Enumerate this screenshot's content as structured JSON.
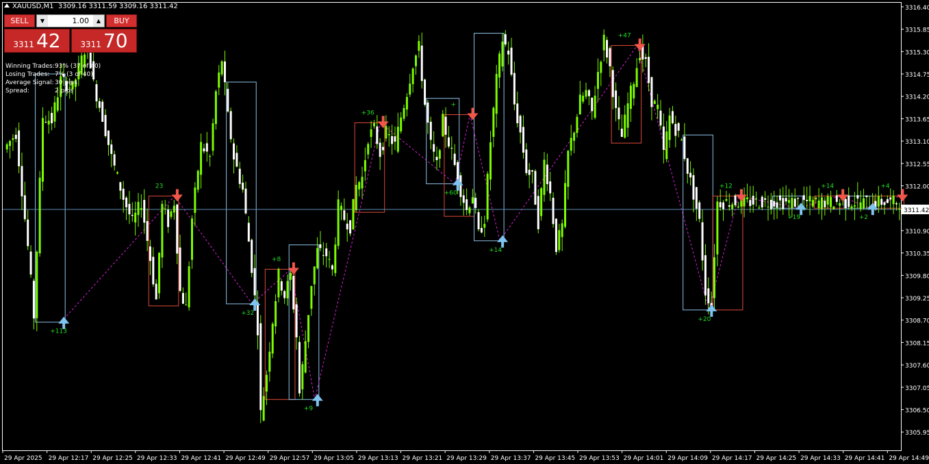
{
  "header": {
    "symbol": "XAUUSD,M1",
    "ohlc": "3309.16 3311.59 3309.16 3311.42"
  },
  "trade_panel": {
    "sell_label": "SELL",
    "buy_label": "BUY",
    "lot": "1.00",
    "sell_small": "3311",
    "sell_big": "42",
    "buy_small": "3311",
    "buy_big": "70",
    "spin_down": "▼",
    "spin_up": "▲"
  },
  "stats": [
    {
      "key": "Winning Trades:",
      "value": "93% (37 of 40)"
    },
    {
      "key": "Losing Trades:",
      "value": "7% (3 of 40)"
    },
    {
      "key": "Average Signal:",
      "value": "30 pips"
    },
    {
      "key": "Spread:",
      "value": "2 pips"
    }
  ],
  "colors": {
    "background": "#000000",
    "bull_candle": "#7CFC00",
    "bear_candle": "#FFFFFF",
    "sell_box": "#E04B3A",
    "buy_box": "#8EC3E8",
    "sell_arrow": "#F0574A",
    "buy_arrow": "#7FC4F0",
    "zigzag": "#E020E0",
    "bid_line": "#5B8DB8",
    "axis": "#FFFFFF",
    "label_green": "#22DD22"
  },
  "chart_data": {
    "type": "candlestick",
    "symbol": "XAUUSD",
    "timeframe": "M1",
    "ylim": [
      3305.5,
      3316.5
    ],
    "y_ticks": [
      "3316.40",
      "3315.85",
      "3315.30",
      "3314.75",
      "3314.20",
      "3313.65",
      "3313.10",
      "3312.55",
      "3312.00",
      "3311.42",
      "3310.90",
      "3310.35",
      "3309.80",
      "3309.25",
      "3308.70",
      "3308.15",
      "3307.60",
      "3307.05",
      "3306.50",
      "3305.95"
    ],
    "x_ticks": [
      "29 Apr 2025",
      "29 Apr 12:17",
      "29 Apr 12:25",
      "29 Apr 12:33",
      "29 Apr 12:41",
      "29 Apr 12:49",
      "29 Apr 12:57",
      "29 Apr 13:05",
      "29 Apr 13:13",
      "29 Apr 13:21",
      "29 Apr 13:29",
      "29 Apr 13:37",
      "29 Apr 13:45",
      "29 Apr 13:53",
      "29 Apr 14:01",
      "29 Apr 14:09",
      "29 Apr 14:17",
      "29 Apr 14:25",
      "29 Apr 14:33",
      "29 Apr 14:41",
      "29 Apr 14:49"
    ],
    "current_price": 3311.42,
    "anchors": [
      [
        0,
        3312.9
      ],
      [
        4,
        3313.3
      ],
      [
        8,
        3310.5
      ],
      [
        10,
        3308.8
      ],
      [
        13,
        3313.7
      ],
      [
        16,
        3313.6
      ],
      [
        19,
        3314.6
      ],
      [
        23,
        3314.4
      ],
      [
        26,
        3315.1
      ],
      [
        28,
        3315.6
      ],
      [
        30,
        3314.5
      ],
      [
        33,
        3313.7
      ],
      [
        36,
        3312.7
      ],
      [
        40,
        3311.7
      ],
      [
        43,
        3311.1
      ],
      [
        46,
        3311.6
      ],
      [
        49,
        3310.2
      ],
      [
        51,
        3309.2
      ],
      [
        53,
        3311.5
      ],
      [
        55,
        3311.1
      ],
      [
        57,
        3311.6
      ],
      [
        59,
        3309.4
      ],
      [
        61,
        3309.0
      ],
      [
        63,
        3311.2
      ],
      [
        66,
        3313.0
      ],
      [
        69,
        3312.7
      ],
      [
        71,
        3314.3
      ],
      [
        73,
        3315.1
      ],
      [
        75,
        3313.7
      ],
      [
        77,
        3312.7
      ],
      [
        80,
        3311.9
      ],
      [
        83,
        3310.0
      ],
      [
        85,
        3308.5
      ],
      [
        86,
        3306.4
      ],
      [
        88,
        3307.4
      ],
      [
        90,
        3308.7
      ],
      [
        92,
        3309.8
      ],
      [
        94,
        3309.3
      ],
      [
        96,
        3309.8
      ],
      [
        98,
        3308.3
      ],
      [
        99,
        3306.9
      ],
      [
        101,
        3308.2
      ],
      [
        103,
        3309.6
      ],
      [
        105,
        3310.4
      ],
      [
        108,
        3310.3
      ],
      [
        110,
        3309.9
      ],
      [
        112,
        3311.5
      ],
      [
        114,
        3311.2
      ],
      [
        116,
        3311.0
      ],
      [
        118,
        3312.0
      ],
      [
        120,
        3312.2
      ],
      [
        122,
        3313.2
      ],
      [
        124,
        3313.4
      ],
      [
        126,
        3312.8
      ],
      [
        128,
        3313.3
      ],
      [
        131,
        3313.0
      ],
      [
        133,
        3313.7
      ],
      [
        135,
        3314.3
      ],
      [
        137,
        3315.0
      ],
      [
        139,
        3315.4
      ],
      [
        141,
        3314.0
      ],
      [
        143,
        3313.0
      ],
      [
        145,
        3312.5
      ],
      [
        147,
        3313.6
      ],
      [
        150,
        3312.8
      ],
      [
        153,
        3311.9
      ],
      [
        155,
        3311.4
      ],
      [
        157,
        3311.8
      ],
      [
        159,
        3310.8
      ],
      [
        161,
        3311.2
      ],
      [
        163,
        3313.1
      ],
      [
        165,
        3314.6
      ],
      [
        167,
        3315.6
      ],
      [
        169,
        3315.3
      ],
      [
        171,
        3314.0
      ],
      [
        173,
        3313.3
      ],
      [
        175,
        3312.4
      ],
      [
        177,
        3312.2
      ],
      [
        179,
        3311.1
      ],
      [
        181,
        3312.6
      ],
      [
        183,
        3311.8
      ],
      [
        185,
        3310.5
      ],
      [
        187,
        3311.0
      ],
      [
        189,
        3312.8
      ],
      [
        191,
        3313.4
      ],
      [
        193,
        3314.1
      ],
      [
        195,
        3314.3
      ],
      [
        197,
        3313.8
      ],
      [
        199,
        3314.8
      ],
      [
        201,
        3315.6
      ],
      [
        203,
        3314.9
      ],
      [
        205,
        3313.8
      ],
      [
        207,
        3313.2
      ],
      [
        209,
        3314.0
      ],
      [
        211,
        3314.6
      ],
      [
        213,
        3315.3
      ],
      [
        215,
        3315.0
      ],
      [
        217,
        3314.1
      ],
      [
        219,
        3313.9
      ],
      [
        221,
        3312.8
      ],
      [
        223,
        3313.7
      ],
      [
        225,
        3313.4
      ],
      [
        227,
        3313.1
      ],
      [
        229,
        3312.4
      ],
      [
        231,
        3311.8
      ],
      [
        233,
        3311.1
      ],
      [
        235,
        3309.4
      ],
      [
        237,
        3309.1
      ],
      [
        239,
        3311.6
      ]
    ],
    "signals": [
      {
        "dir": "buy",
        "label": "+113",
        "i0": 10,
        "i1": 20
      },
      {
        "dir": "sell",
        "label": "23",
        "i0": 48,
        "i1": 58
      },
      {
        "dir": "buy",
        "label": "+32",
        "i0": 74,
        "i1": 84
      },
      {
        "dir": "sell",
        "label": "+8",
        "i0": 87,
        "i1": 97
      },
      {
        "dir": "buy",
        "label": "+9",
        "i0": 95,
        "i1": 105
      },
      {
        "dir": "sell",
        "label": "+36",
        "i0": 117,
        "i1": 127
      },
      {
        "dir": "buy",
        "label": "+60",
        "i0": 141,
        "i1": 152
      },
      {
        "dir": "sell",
        "label": "+",
        "i0": 147,
        "i1": 157
      },
      {
        "dir": "buy",
        "label": "+14",
        "i0": 157,
        "i1": 167
      },
      {
        "dir": "sell",
        "label": "+47",
        "i0": 203,
        "i1": 213
      },
      {
        "dir": "buy",
        "label": "+20",
        "i0": 227,
        "i1": 237
      },
      {
        "dir": "sell",
        "label": "+12",
        "i0": 237,
        "i1": 247
      },
      {
        "dir": "buy",
        "label": "+19",
        "i0": 257,
        "i1": 267
      },
      {
        "dir": "sell",
        "label": "+14",
        "i0": 271,
        "i1": 281
      },
      {
        "dir": "buy",
        "label": "+2",
        "i0": 281,
        "i1": 291
      },
      {
        "dir": "sell",
        "label": "+4",
        "i0": 291,
        "i1": 301
      }
    ]
  }
}
